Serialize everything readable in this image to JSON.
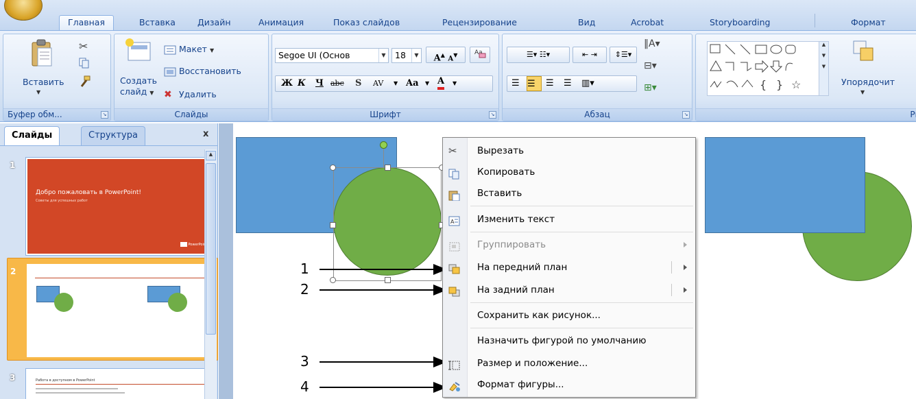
{
  "ribbon_tabs": [
    {
      "label": "Главная",
      "active": true
    },
    {
      "label": "Вставка"
    },
    {
      "label": "Дизайн"
    },
    {
      "label": "Анимация"
    },
    {
      "label": "Показ слайдов"
    },
    {
      "label": "Рецензирование"
    },
    {
      "label": "Вид"
    },
    {
      "label": "Acrobat"
    },
    {
      "label": "Storyboarding"
    },
    {
      "label": "Формат"
    }
  ],
  "clipboard": {
    "paste": "Вставить",
    "group": "Буфер обм..."
  },
  "slides_group": {
    "create": "Создать",
    "create2": "слайд",
    "layout": "Макет",
    "reset": "Восстановить",
    "delete": "Удалить",
    "group": "Слайды"
  },
  "font_group": {
    "font_name": "Segoe UI (Основ",
    "font_size": "18",
    "bold": "Ж",
    "italic": "К",
    "underline": "Ч",
    "strike": "abc",
    "shadow": "S",
    "spacing": "AV",
    "case": "Aa",
    "color": "A",
    "grow": "A",
    "shrink": "A",
    "group": "Шрифт"
  },
  "paragraph_group": {
    "group": "Абзац"
  },
  "drawing_group": {
    "arrange": "Упорядочит",
    "group": "Рис"
  },
  "left_pane": {
    "tab_slides": "Слайды",
    "tab_outline": "Структура",
    "close": "x",
    "thumbs": [
      {
        "num": "1",
        "title": "Добро пожаловать в PowerPoint!",
        "subtitle": "Советы для успешных работ",
        "logo": "PowerPoint"
      },
      {
        "num": "2"
      },
      {
        "num": "3",
        "title": "Работа в доступном в PowerPoint"
      }
    ]
  },
  "context_menu": {
    "items": [
      {
        "label": "Вырезать",
        "icon": "scissors-icon"
      },
      {
        "label": "Копировать",
        "icon": "copy-icon"
      },
      {
        "label": "Вставить",
        "icon": "paste-icon"
      },
      {
        "label": "Изменить текст",
        "icon": "edit-text-icon"
      },
      {
        "label": "Группировать",
        "icon": "group-icon",
        "disabled": true
      },
      {
        "label": "На передний план",
        "icon": "bring-front-icon"
      },
      {
        "label": "На задний план",
        "icon": "send-back-icon"
      },
      {
        "label": "Сохранить как рисунок...",
        "icon": ""
      },
      {
        "label": "Назначить фигурой по умолчанию",
        "icon": ""
      },
      {
        "label": "Размер и положение...",
        "icon": "size-position-icon"
      },
      {
        "label": "Формат фигуры...",
        "icon": "format-shape-icon"
      }
    ]
  },
  "callouts": [
    "1",
    "2",
    "3",
    "4"
  ],
  "colors": {
    "shape_blue": "#5b9bd5",
    "shape_green": "#70ad47",
    "slide1_bg": "#d24726",
    "selected_thumb": "#f8b848"
  }
}
